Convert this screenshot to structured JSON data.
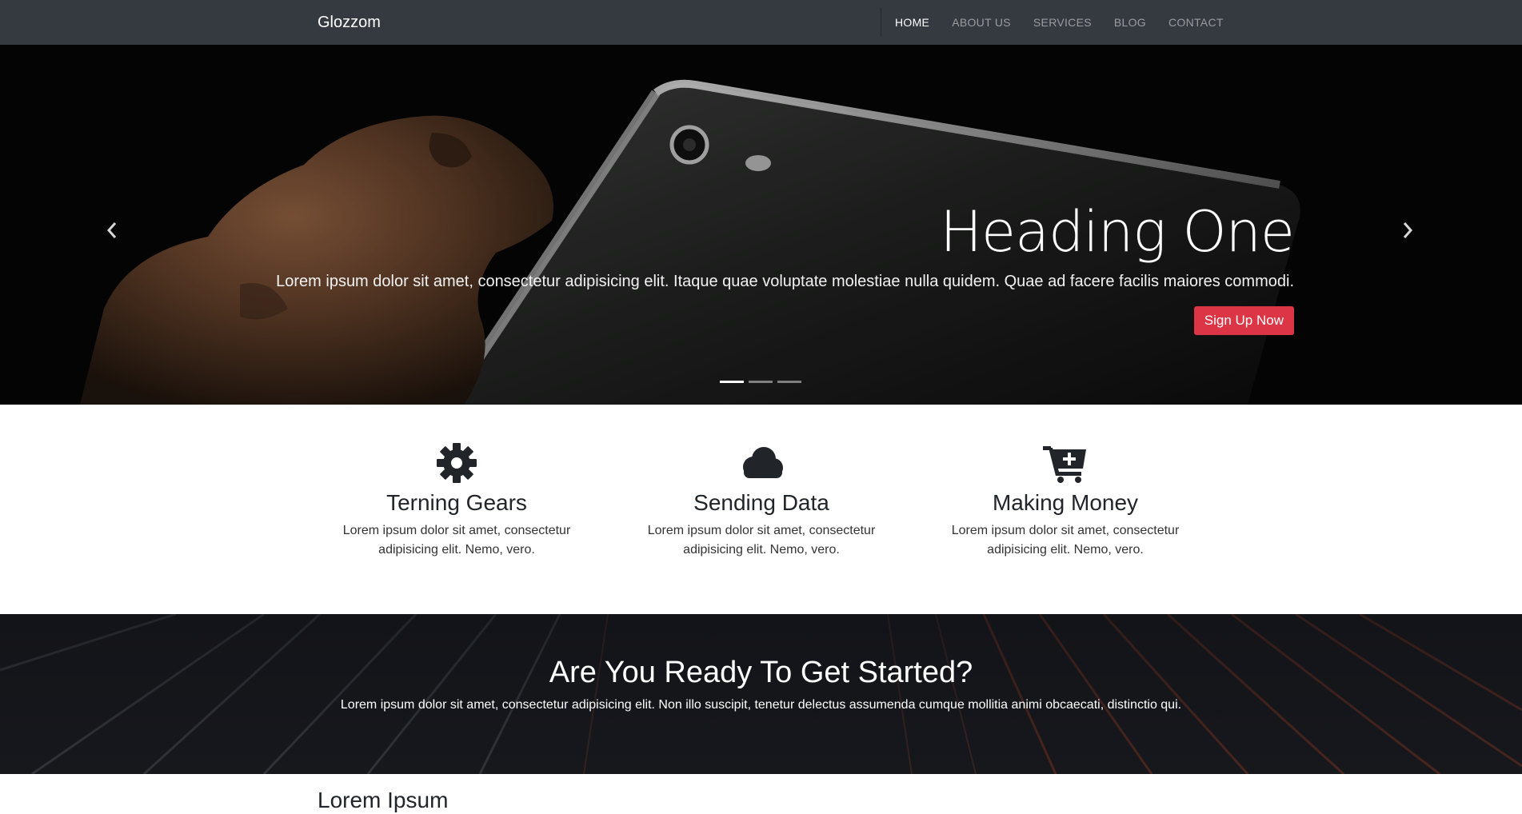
{
  "navbar": {
    "brand": "Glozzom",
    "links": [
      {
        "label": "HOME",
        "active": true
      },
      {
        "label": "ABOUT US",
        "active": false
      },
      {
        "label": "SERVICES",
        "active": false
      },
      {
        "label": "BLOG",
        "active": false
      },
      {
        "label": "CONTACT",
        "active": false
      }
    ]
  },
  "hero": {
    "heading": "Heading One",
    "text": "Lorem ipsum dolor sit amet, consectetur adipisicing elit. Itaque quae voluptate molestiae nulla quidem. Quae ad facere facilis maiores commodi.",
    "button_label": "Sign Up Now",
    "slide_count": 3,
    "active_slide": 1,
    "prev_icon": "chevron-left-icon",
    "next_icon": "chevron-right-icon"
  },
  "features": [
    {
      "icon": "gear-icon",
      "title": "Terning Gears",
      "text": "Lorem ipsum dolor sit amet, consectetur adipisicing elit. Nemo, vero."
    },
    {
      "icon": "cloud-icon",
      "title": "Sending Data",
      "text": "Lorem ipsum dolor sit amet, consectetur adipisicing elit. Nemo, vero."
    },
    {
      "icon": "cart-plus-icon",
      "title": "Making Money",
      "text": "Lorem ipsum dolor sit amet, consectetur adipisicing elit. Nemo, vero."
    }
  ],
  "cta": {
    "title": "Are You Ready To Get Started?",
    "text": "Lorem ipsum dolor sit amet, consectetur adipisicing elit. Non illo suscipit, tenetur delectus assumenda cumque mollitia animi obcaecati, distinctio qui."
  },
  "bottom": {
    "heading": "Lorem Ipsum"
  },
  "colors": {
    "navbar_bg": "#343a40",
    "accent_red": "#dc3545",
    "icon_dark": "#212529"
  }
}
